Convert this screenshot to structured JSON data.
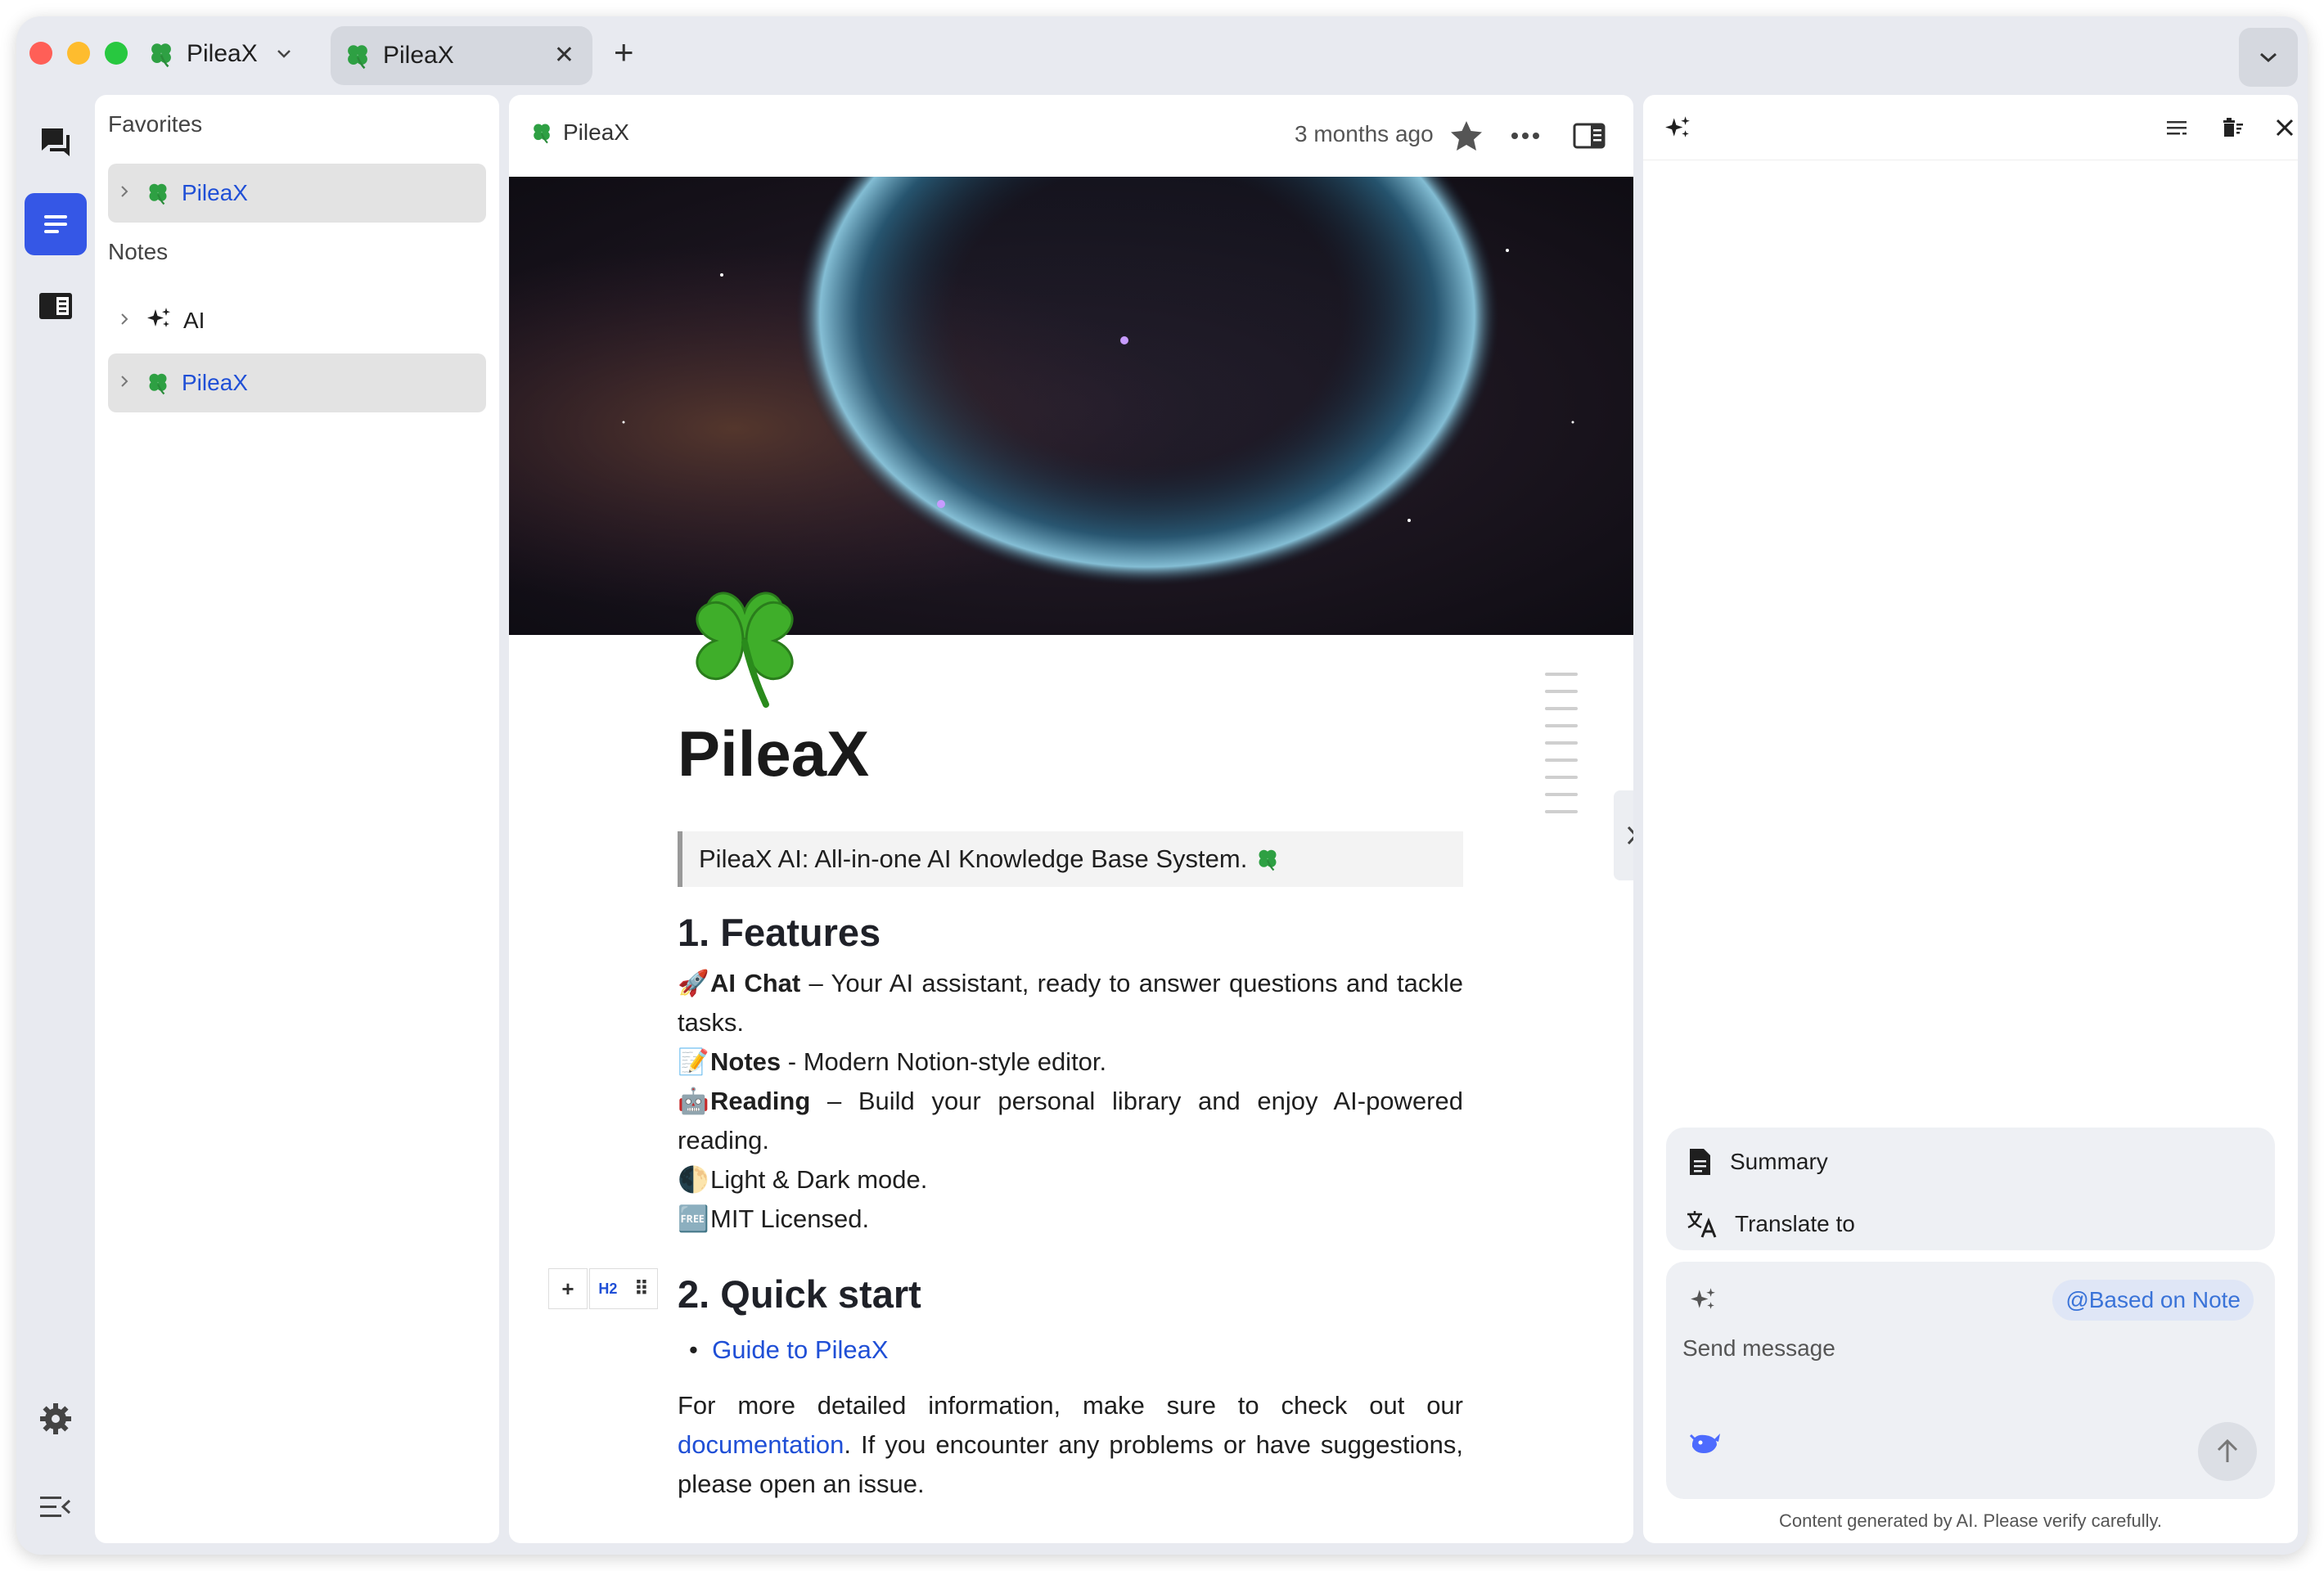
{
  "titlebar": {
    "app_name": "PileaX",
    "tab_label": "PileaX",
    "tab_close": "✕",
    "new_tab": "+"
  },
  "sidebar": {
    "favorites_heading": "Favorites",
    "favorites": [
      {
        "label": "PileaX"
      }
    ],
    "notes_heading": "Notes",
    "notes": [
      {
        "label": "AI"
      },
      {
        "label": "PileaX"
      }
    ]
  },
  "editor": {
    "breadcrumb": "PileaX",
    "updated": "3 months ago",
    "title": "PileaX",
    "quote": "PileaX AI: All-in-one AI Knowledge Base System.",
    "features_heading": "1. Features",
    "features": [
      {
        "emoji": "🚀",
        "bold": "AI Chat",
        "text": " – Your AI assistant, ready to answer questions and tackle tasks."
      },
      {
        "emoji": "📝",
        "bold": "Notes",
        "text": " - Modern Notion-style editor."
      },
      {
        "emoji": "🤖",
        "bold": "Reading",
        "text": " – Build your personal library and enjoy AI-powered reading."
      },
      {
        "emoji": "🌓",
        "bold": "",
        "text": "Light & Dark mode."
      },
      {
        "emoji": "🆓",
        "bold": "",
        "text": "MIT Licensed."
      }
    ],
    "quickstart_heading": "2. Quick start",
    "guide_link": "Guide to PileaX",
    "more_info_prefix": "For more detailed information, make sure to check out our ",
    "more_info_link": "documentation",
    "more_info_suffix": ". If you encounter any problems or have suggestions, please open an issue.",
    "block_add": "+",
    "block_type": "H2",
    "block_drag": "⠿"
  },
  "ai_panel": {
    "quick_actions": [
      {
        "label": "Summary"
      },
      {
        "label": "Translate to"
      }
    ],
    "based_on": "@Based on Note",
    "placeholder": "Send message",
    "disclaimer": "Content generated by AI. Please verify carefully."
  },
  "colors": {
    "accent": "#3557e6",
    "link": "#1f4fd6",
    "window_bg": "#e8eaf0"
  }
}
